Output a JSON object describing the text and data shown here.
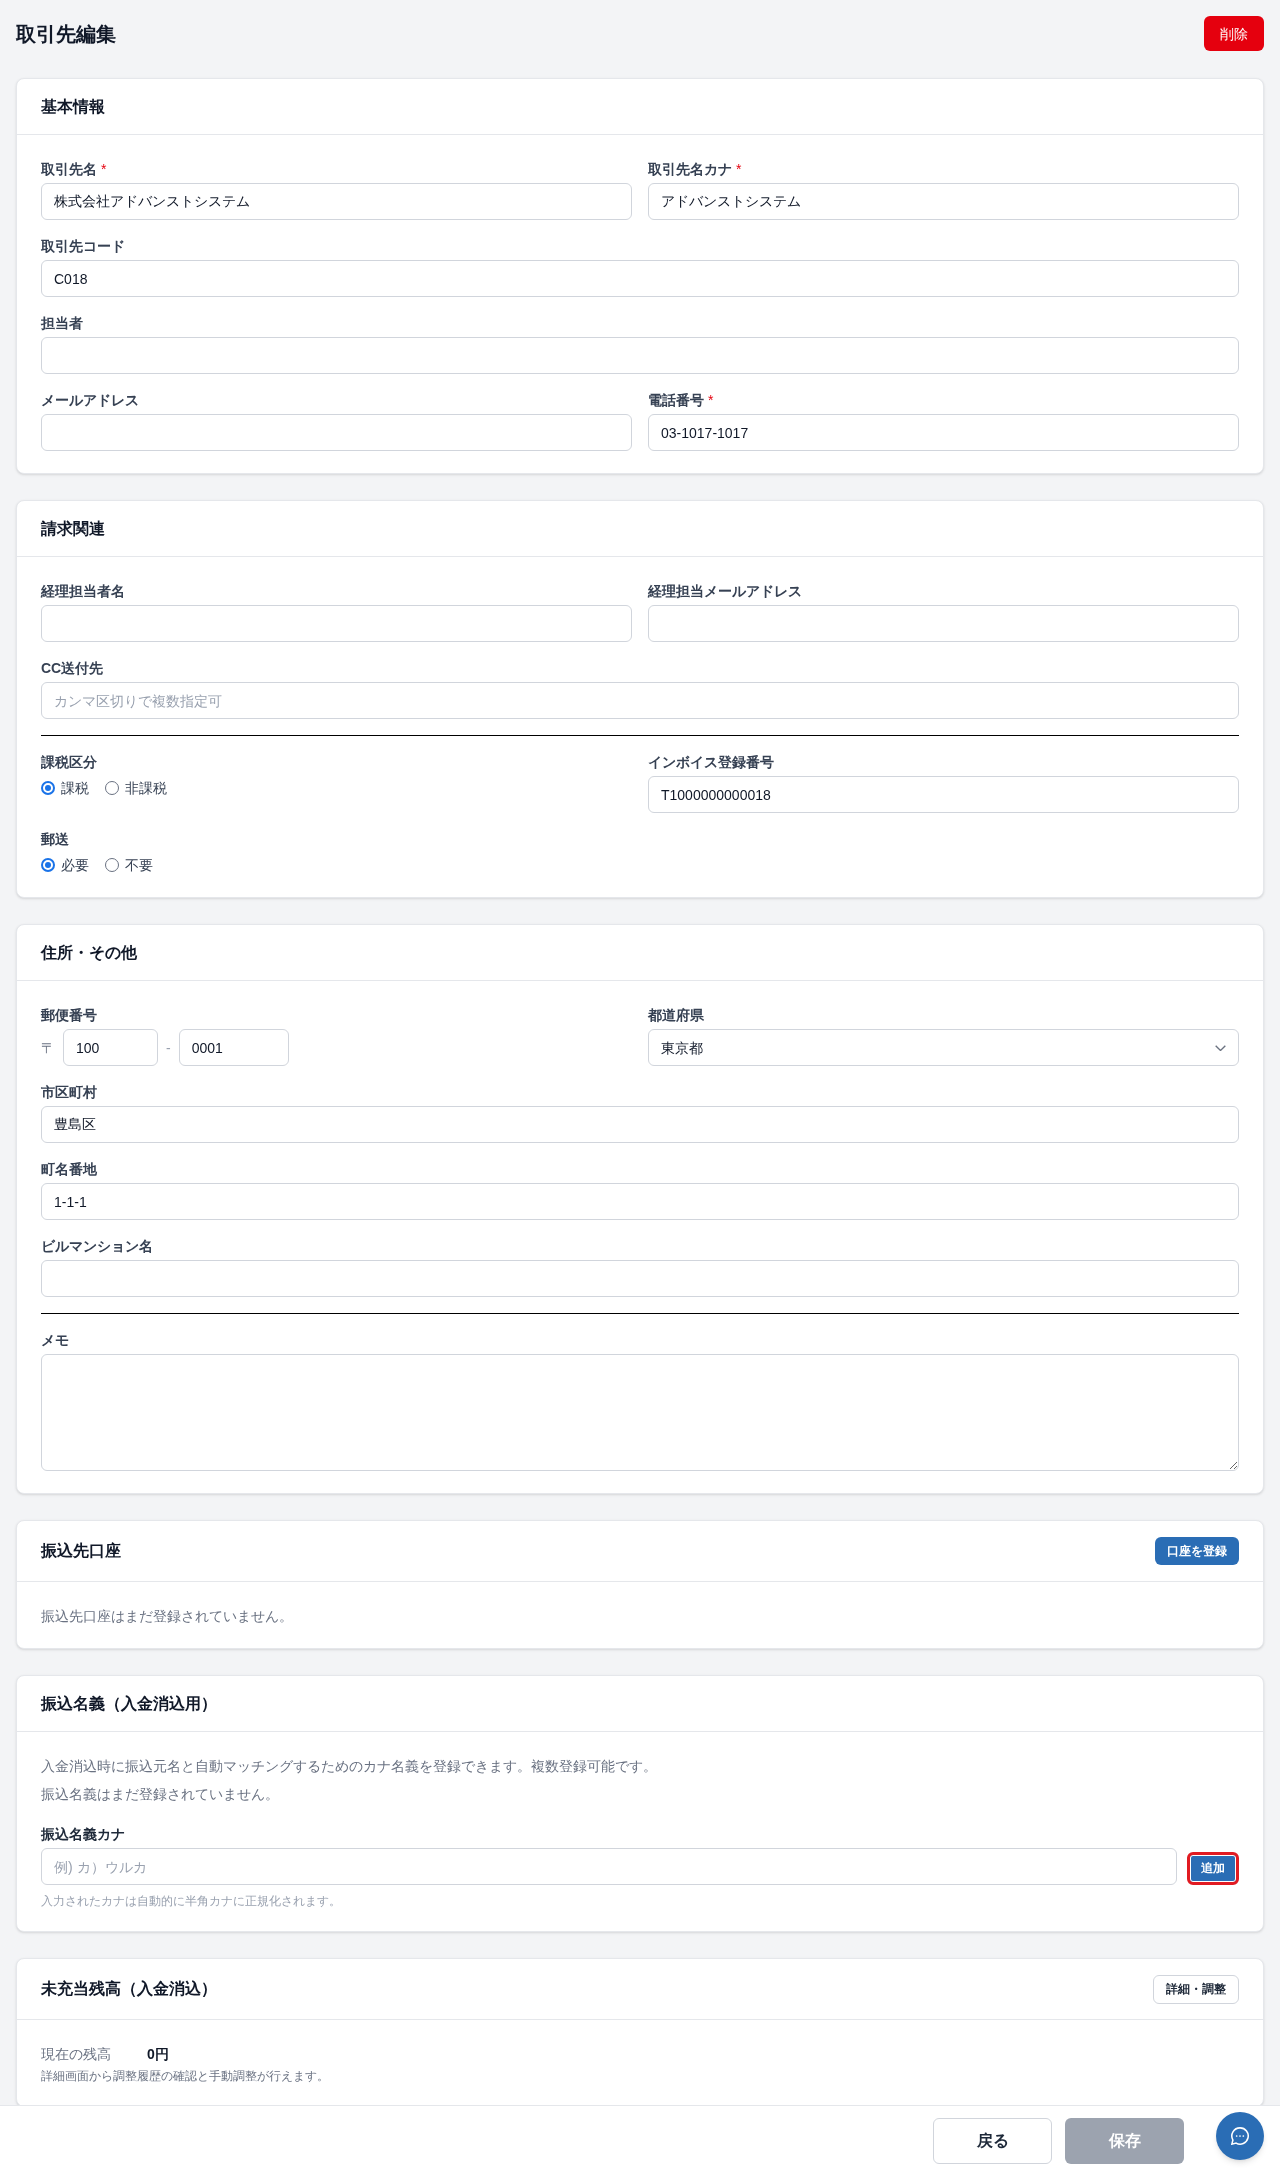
{
  "header": {
    "title": "取引先編集",
    "delete_button": {
      "label": "削除"
    }
  },
  "sections": [
    {
      "title": "基本情報",
      "rows": [
        {
          "kind": "fields",
          "fields": [
            {
              "kind": "input",
              "label": "取引先名",
              "required_mark": "*",
              "value": "株式会社アドバンストシステム"
            },
            {
              "kind": "input",
              "label": "取引先名カナ",
              "required_mark": "*",
              "value": "アドバンストシステム"
            }
          ]
        },
        {
          "kind": "fields",
          "fields": [
            {
              "kind": "input",
              "label": "取引先コード",
              "value": "C018"
            }
          ]
        },
        {
          "kind": "fields",
          "fields": [
            {
              "kind": "input",
              "label": "担当者"
            }
          ]
        },
        {
          "kind": "fields",
          "fields": [
            {
              "kind": "input",
              "label": "メールアドレス"
            },
            {
              "kind": "input",
              "label": "電話番号",
              "required_mark": "*",
              "value": "03-1017-1017"
            }
          ]
        }
      ]
    },
    {
      "title": "請求関連",
      "rows": [
        {
          "kind": "fields",
          "fields": [
            {
              "kind": "input",
              "label": "経理担当者名"
            },
            {
              "kind": "input",
              "label": "経理担当メールアドレス"
            }
          ]
        },
        {
          "kind": "fields",
          "fields": [
            {
              "kind": "input",
              "label": "CC送付先",
              "placeholder": "カンマ区切りで複数指定可"
            }
          ]
        },
        {
          "kind": "divider"
        },
        {
          "kind": "fields",
          "fields": [
            {
              "kind": "radio",
              "label": "課税区分",
              "options": [
                {
                  "label": "課税",
                  "selected": true
                },
                {
                  "label": "非課税",
                  "selected": false
                }
              ]
            },
            {
              "kind": "input",
              "label": "インボイス登録番号",
              "value": "T1000000000018"
            }
          ]
        },
        {
          "kind": "fields",
          "fields": [
            {
              "kind": "radio",
              "label": "郵送",
              "options": [
                {
                  "label": "必要",
                  "selected": true
                },
                {
                  "label": "不要",
                  "selected": false
                }
              ]
            }
          ]
        }
      ]
    },
    {
      "title": "住所・その他",
      "rows": [
        {
          "kind": "fields",
          "fields": [
            {
              "kind": "postal",
              "label": "郵便番号",
              "prefix": "〒",
              "separator": "-",
              "parts": [
                "100",
                "0001"
              ]
            },
            {
              "kind": "select",
              "label": "都道府県",
              "value": "東京都"
            }
          ]
        },
        {
          "kind": "fields",
          "fields": [
            {
              "kind": "input",
              "label": "市区町村",
              "value": "豊島区"
            }
          ]
        },
        {
          "kind": "fields",
          "fields": [
            {
              "kind": "input",
              "label": "町名番地",
              "value": "1-1-1"
            }
          ]
        },
        {
          "kind": "fields",
          "fields": [
            {
              "kind": "input",
              "label": "ビルマンション名"
            }
          ]
        },
        {
          "kind": "divider"
        },
        {
          "kind": "fields",
          "fields": [
            {
              "kind": "textarea",
              "label": "メモ"
            }
          ]
        }
      ]
    },
    {
      "title": "振込先口座",
      "button": {
        "kind": "primary",
        "label": "口座を登録"
      },
      "rows": [
        {
          "kind": "note",
          "text": "振込先口座はまだ登録されていません。"
        }
      ]
    },
    {
      "title": "振込名義（入金消込用）",
      "rows": [
        {
          "kind": "note",
          "text": "入金消込時に振込元名と自動マッチングするためのカナ名義を登録できます。複数登録可能です。"
        },
        {
          "kind": "note",
          "text": "振込名義はまだ登録されていません。"
        },
        {
          "kind": "add_input",
          "label": "振込名義カナ",
          "placeholder": "例) カ）ウルカ",
          "button": {
            "label": "追加",
            "highlighted": true
          },
          "hint": "入力されたカナは自動的に半角カナに正規化されます。"
        }
      ]
    },
    {
      "title": "未充当残高（入金消込）",
      "button": {
        "kind": "outline",
        "label": "詳細・調整"
      },
      "rows": [
        {
          "kind": "balance",
          "label": "現在の残高",
          "value": "0円"
        },
        {
          "kind": "hint",
          "text": "詳細画面から調整履歴の確認と手動調整が行えます。"
        }
      ]
    }
  ],
  "footer": {
    "buttons": [
      {
        "kind": "outline",
        "label": "戻る",
        "disabled": false
      },
      {
        "kind": "primary",
        "label": "保存",
        "disabled": true
      }
    ]
  }
}
